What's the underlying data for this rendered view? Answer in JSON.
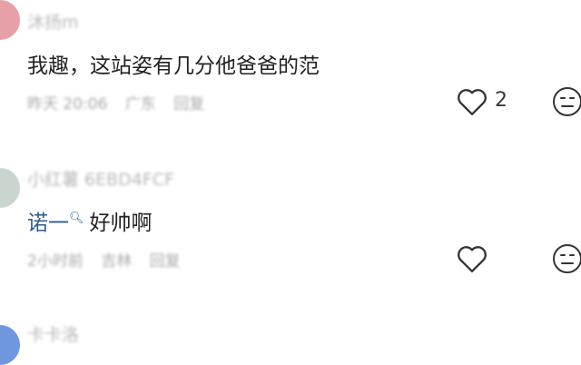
{
  "comments": [
    {
      "username": "沐扬m",
      "content": "我趣，这站姿有几分他爸爸的范",
      "time": "昨天 20:06",
      "location": "广东",
      "reply": "回复",
      "likes": "2",
      "avatar_color": "#e7a0a8"
    },
    {
      "username": "小红薯 6EBD4FCF",
      "mention": "诺一",
      "content": "好帅啊",
      "time": "2小时前",
      "location": "吉林",
      "reply": "回复",
      "avatar_color": "#c9d6cf"
    },
    {
      "username": "卡卡洛",
      "avatar_color": "#6f97e0"
    }
  ]
}
